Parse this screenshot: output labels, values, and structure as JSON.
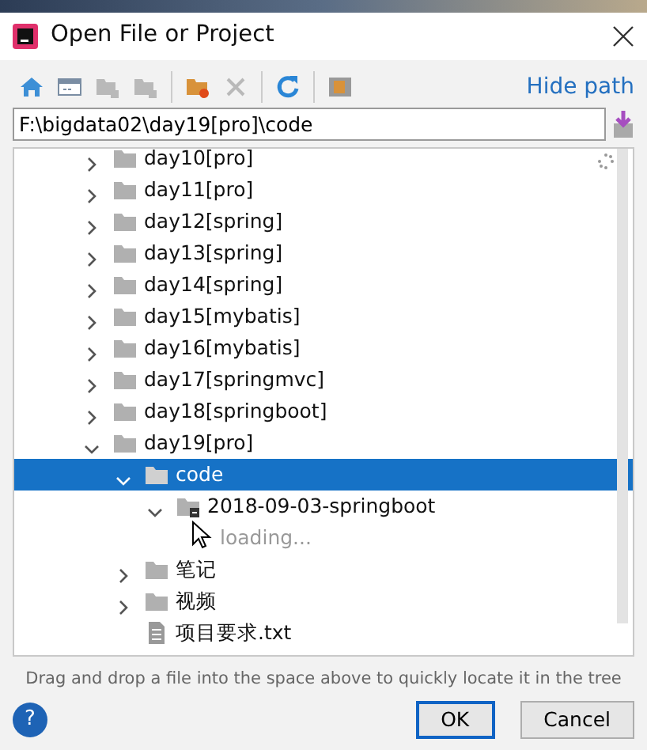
{
  "window": {
    "title": "Open File or Project"
  },
  "toolbar": {
    "groups": [
      [
        {
          "kind": "home",
          "disabled": false
        },
        {
          "kind": "desktop",
          "disabled": false
        },
        {
          "kind": "project",
          "disabled": true
        },
        {
          "kind": "module",
          "disabled": true
        }
      ],
      [
        {
          "kind": "new-folder",
          "disabled": false
        },
        {
          "kind": "delete",
          "disabled": true
        }
      ],
      [
        {
          "kind": "refresh",
          "disabled": false
        }
      ],
      [
        {
          "kind": "show-hidden",
          "disabled": false
        }
      ]
    ],
    "hide_path": "Hide path"
  },
  "path_field": {
    "value": "F:\\bigdata02\\day19[pro]\\code"
  },
  "tree": [
    {
      "label": "day10[pro]",
      "kind": "folder",
      "expanded": false,
      "selected": false
    },
    {
      "label": "day11[pro]",
      "kind": "folder",
      "expanded": false,
      "selected": false
    },
    {
      "label": "day12[spring]",
      "kind": "folder",
      "expanded": false,
      "selected": false
    },
    {
      "label": "day13[spring]",
      "kind": "folder",
      "expanded": false,
      "selected": false
    },
    {
      "label": "day14[spring]",
      "kind": "folder",
      "expanded": false,
      "selected": false
    },
    {
      "label": "day15[mybatis]",
      "kind": "folder",
      "expanded": false,
      "selected": false
    },
    {
      "label": "day16[mybatis]",
      "kind": "folder",
      "expanded": false,
      "selected": false
    },
    {
      "label": "day17[springmvc]",
      "kind": "folder",
      "expanded": false,
      "selected": false
    },
    {
      "label": "day18[springboot]",
      "kind": "folder",
      "expanded": false,
      "selected": false
    },
    {
      "label": "day19[pro]",
      "kind": "folder",
      "expanded": true,
      "selected": false,
      "children": [
        {
          "label": "code",
          "kind": "folder",
          "expanded": true,
          "selected": true,
          "children": [
            {
              "label": "2018-09-03-springboot",
              "kind": "module",
              "expanded": true,
              "selected": false,
              "children": [
                {
                  "label": "loading...",
                  "kind": "loading",
                  "selected": false
                }
              ]
            }
          ]
        },
        {
          "label": "笔记",
          "kind": "folder",
          "expanded": false,
          "selected": false
        },
        {
          "label": "视频",
          "kind": "folder",
          "expanded": false,
          "selected": false
        },
        {
          "label": "项目要求.txt",
          "kind": "file",
          "selected": false
        }
      ]
    }
  ],
  "hint": "Drag and drop a file into the space above to quickly locate it in the tree",
  "help": "?",
  "buttons": [
    {
      "label": "OK",
      "default": true
    },
    {
      "label": "Cancel",
      "default": false
    }
  ]
}
